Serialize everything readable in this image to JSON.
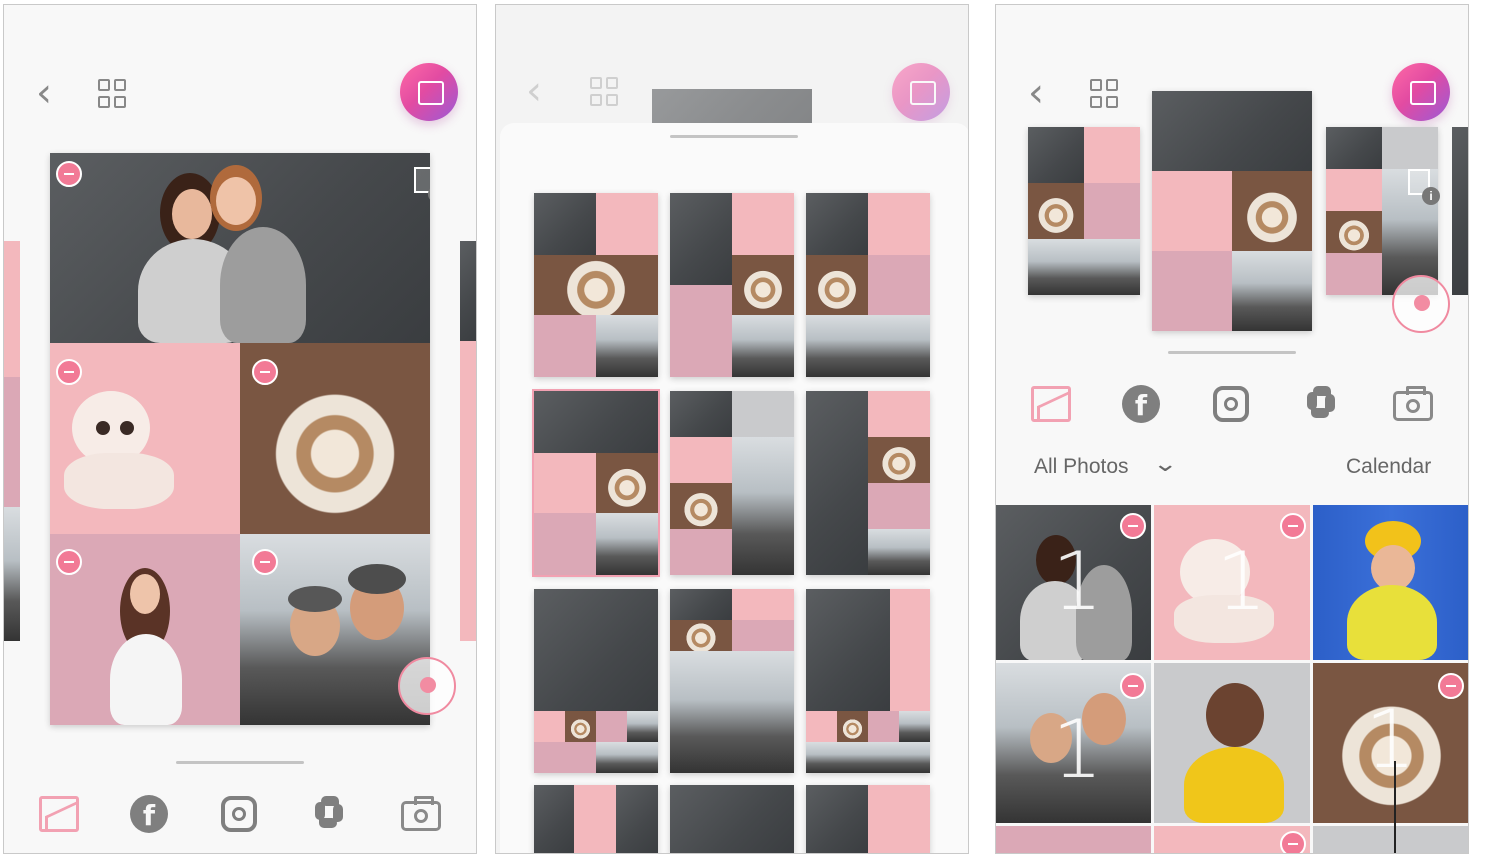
{
  "screen3": {
    "album_label": "All Photos",
    "calendar_label": "Calendar",
    "count_marker": "1"
  },
  "icons": {
    "back": "back-arrow-icon",
    "layout": "grid-layout-icon",
    "print": "print-icon",
    "gallery": "gallery-icon",
    "facebook": "facebook-icon",
    "instagram": "instagram-icon",
    "google_photos": "pinwheel-icon",
    "camera": "camera-icon",
    "dropdown": "chevron-down-icon"
  },
  "colors": {
    "accent_pink": "#f27a96",
    "print_gradient_start": "#ff6aa6",
    "print_gradient_end": "#9b5ad6",
    "icon_grey": "#7f7f7f"
  }
}
